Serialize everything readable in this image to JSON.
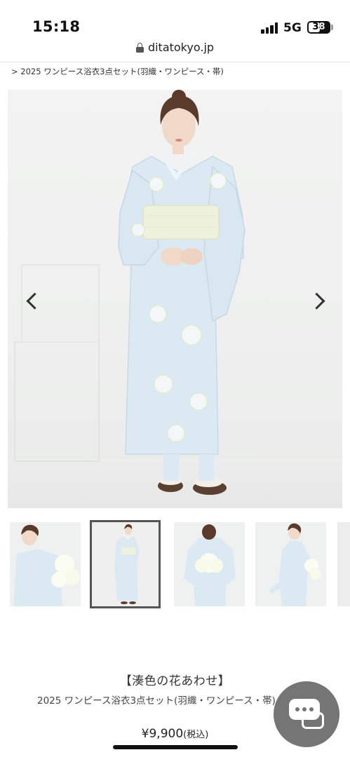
{
  "status": {
    "time": "15:18",
    "network": "5G",
    "battery": "38"
  },
  "browser": {
    "url": "ditatokyo.jp"
  },
  "breadcrumb": {
    "text": "> 2025 ワンピース浴衣3点セット(羽織・ワンピース・帯)"
  },
  "product": {
    "title": "【湊色の花あわせ】",
    "subtitle": "2025 ワンピース浴衣3点セット(羽織・ワンピース・帯)",
    "price": "¥9,900",
    "tax_note": "(税込)"
  },
  "colors": {
    "yukata": "#dbe9f2",
    "obi": "#eef1dc",
    "hair": "#5a3a2a",
    "skin": "#f1d9c9",
    "chat_button": "#6a6a6a"
  },
  "icons": [
    "lock-icon",
    "chevron-left-icon",
    "chevron-right-icon",
    "chat-icon"
  ]
}
